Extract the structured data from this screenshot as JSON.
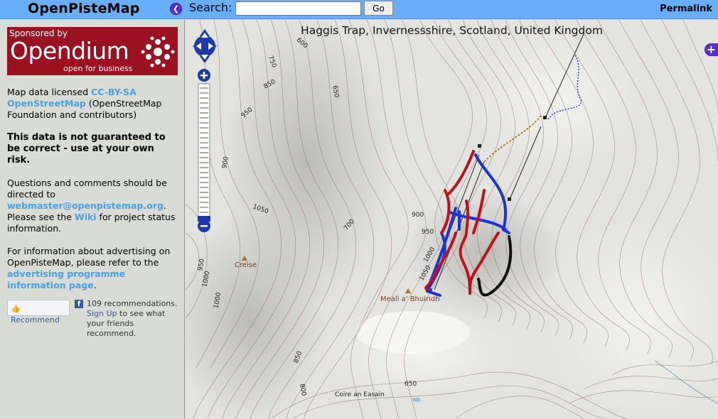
{
  "header": {
    "title": "OpenPisteMap",
    "collapse_glyph": "❮",
    "search_label": "Search:",
    "search_value": "",
    "go_label": "Go",
    "permalink": "Permalink"
  },
  "sidebar": {
    "sponsor": {
      "caption": "Sponsored by",
      "name": "Opendium",
      "tagline": "open for business"
    },
    "license": {
      "prefix": "Map data licensed ",
      "license_link": "CC-BY-SA",
      "osm_link": "OpenStreetMap",
      "suffix": " (OpenStreetMap Foundation and contributors)"
    },
    "warning": "This data is not guaranteed to be correct - use at your own risk.",
    "contact": {
      "prefix": "Questions and comments should be directed to ",
      "email": "webmaster@openpistemap.org",
      "middle": ". Please see the ",
      "wiki": "Wiki",
      "suffix": " for project status information."
    },
    "advertising": {
      "prefix": "For information about advertising on OpenPisteMap, please refer to the ",
      "link": "advertising programme information page",
      "suffix": "."
    },
    "facebook": {
      "recommend_label": "Recommend",
      "count_text": "109 recommendations.",
      "signup_link": "Sign Up",
      "signup_suffix": " to see what your friends recommend."
    }
  },
  "map": {
    "location": "Haggis Trap, Invernessshire, Scotland, United Kingdom",
    "peaks": [
      {
        "name": "Creise"
      },
      {
        "name": "Meall a' Bhuiridh"
      },
      {
        "name": "Coire an Easain"
      }
    ],
    "contour_labels": [
      "600",
      "750",
      "850",
      "950",
      "900",
      "1050",
      "700",
      "650",
      "900",
      "950",
      "1000",
      "1050",
      "1000",
      "850",
      "800",
      "650",
      "950",
      "1000"
    ],
    "controls": {
      "zoom_in": "+",
      "zoom_out": "−",
      "layer_switcher": "+"
    },
    "colors": {
      "piste_easy": "#1a33d6",
      "piste_intermediate": "#c0101a",
      "piste_expert": "#111111",
      "path": "#9a6a10",
      "header_bg": "#69aef8",
      "sponsor_bg": "#9b1122"
    }
  }
}
